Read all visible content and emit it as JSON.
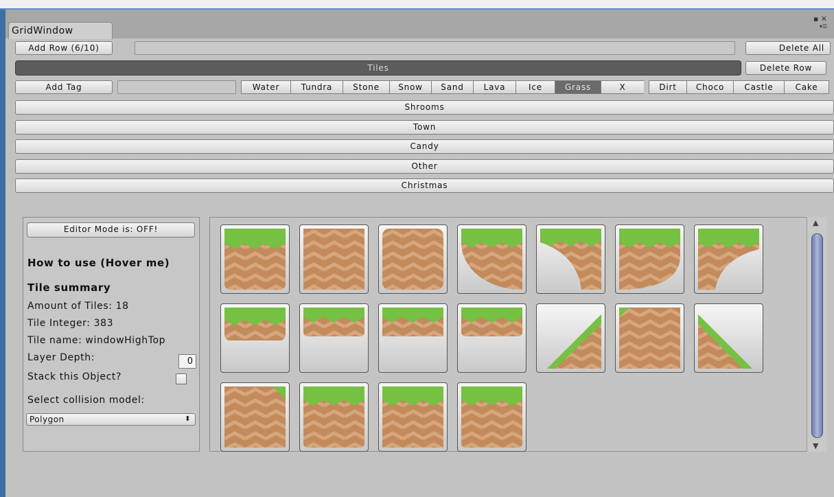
{
  "window": {
    "tab_title": "GridWindow",
    "icons": [
      "maximize-icon",
      "close-icon",
      "menu-icon"
    ]
  },
  "toolbar": {
    "add_row_label": "Add Row (6/10)",
    "add_row_input": "",
    "delete_all_label": "Delete All",
    "tiles_label": "Tiles",
    "delete_row_label": "Delete Row",
    "add_tag_label": "Add Tag",
    "add_tag_input": ""
  },
  "tags": [
    {
      "label": "Water",
      "active": false
    },
    {
      "label": "Tundra",
      "active": false
    },
    {
      "label": "Stone",
      "active": false
    },
    {
      "label": "Snow",
      "active": false
    },
    {
      "label": "Sand",
      "active": false
    },
    {
      "label": "Lava",
      "active": false
    },
    {
      "label": "Ice",
      "active": false
    },
    {
      "label": "Grass",
      "active": true
    },
    {
      "label": "X",
      "active": false
    },
    {
      "label": "Dirt",
      "active": false
    },
    {
      "label": "Choco",
      "active": false
    },
    {
      "label": "Castle",
      "active": false
    },
    {
      "label": "Cake",
      "active": false
    }
  ],
  "foldouts": [
    "Shrooms",
    "Town",
    "Candy",
    "Other",
    "Christmas"
  ],
  "left_panel": {
    "editor_mode_label": "Editor Mode is:  OFF!",
    "how_to_use": "How to use (Hover me)",
    "summary_title": "Tile summary",
    "amount_of_tiles": "Amount of Tiles: 18",
    "tile_integer": "Tile Integer: 383",
    "tile_name": "Tile name: windowHighTop",
    "layer_depth_label": "Layer Depth:",
    "layer_depth_value": "0",
    "stack_label": "Stack this Object?",
    "stack_checked": false,
    "collision_label": "Select collision model:",
    "collision_value": "Polygon"
  },
  "tiles": [
    "grass-block",
    "dirt-block",
    "dirt-rounded",
    "grass-round-left",
    "grass-round-right",
    "grass-half-curve",
    "grass-corner-curve",
    "grass-top-rounded",
    "grass-top-right-edge",
    "grass-top-flat",
    "grass-top-right-round",
    "grass-slope-left",
    "grass-slope-diagonal-block",
    "grass-slope-right",
    "dirt-corner-grass",
    "grass-top-full",
    "grass-top-square",
    "grass-top-left-round"
  ],
  "colors": {
    "grass": "#76c043",
    "grass_dark": "#5aa030",
    "dirt": "#c38a5c",
    "dirt_light": "#d6a67c",
    "tiles_bar": "#5c5c5c",
    "active_tag": "#6b6b6b",
    "scroll_thumb": "#8c9bc6"
  }
}
